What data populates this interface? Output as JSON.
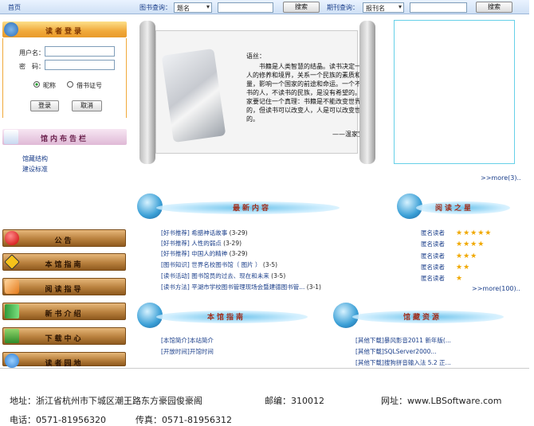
{
  "topbar": {
    "home": "首页",
    "book_query_label": "图书查询：",
    "book_select": "题名",
    "search_btn": "搜索",
    "journal_query_label": "期刊查询：",
    "journal_select": "报刊名",
    "search_btn2": "搜索"
  },
  "login": {
    "title": "读者登录",
    "user_label": "用户名：",
    "pwd_label": "密　码：",
    "radio1": "昵称",
    "radio2": "借书证号",
    "login_btn": "登录",
    "cancel_btn": "取消"
  },
  "bulletin": {
    "title": "馆内布告栏",
    "links": [
      "馆藏结构",
      "建设标准"
    ]
  },
  "scroll": {
    "quote_title": "语丝：",
    "quote_body": "书籍是人类智慧的结晶。读书决定一个人的修养和境界，关系一个民族的素质和力量，影响一个国家的前途和命运。一个不读书的人，不读书的民族，是没有希望的。大家要记住一个真理：书籍是不能改变世界的，但读书可以改变人，人是可以改变世界的。",
    "quote_author": "——温家宝"
  },
  "more1": ">>more(3)..",
  "newest": {
    "title": "最新内容",
    "items": [
      {
        "tag": "[好书推荐]",
        "text": "希腊神话故事",
        "date": "(3-29)"
      },
      {
        "tag": "[好书推荐]",
        "text": "人性的弱点",
        "date": "(3-29)"
      },
      {
        "tag": "[好书推荐]",
        "text": "中国人的精神",
        "date": "(3-29)"
      },
      {
        "tag": "[图书知识]",
        "text": "世界名校图书馆（ 图片 ）",
        "date": "(3-5)"
      },
      {
        "tag": "[读书活动]",
        "text": "图书馆员的过去、现在和未来",
        "date": "(3-5)"
      },
      {
        "tag": "[读书方法]",
        "text": "平湖市学校图书管理现场会暨建德图书管...",
        "date": "(3-1)"
      }
    ]
  },
  "stars": {
    "title": "阅读之星",
    "readers": [
      {
        "name": "匿名读者",
        "stars": "★★★★★"
      },
      {
        "name": "匿名读者",
        "stars": "★★★★"
      },
      {
        "name": "匿名读者",
        "stars": "★★★"
      },
      {
        "name": "匿名读者",
        "stars": "★★"
      },
      {
        "name": "匿名读者",
        "stars": "★"
      }
    ],
    "more": ">>more(100).."
  },
  "leftnav": [
    "公告",
    "本馆指南",
    "阅读指导",
    "新书介绍",
    "下载中心",
    "读者园地"
  ],
  "guide": {
    "title": "本馆指南",
    "items": [
      {
        "tag": "[本馆简介]",
        "text": "本站简介"
      },
      {
        "tag": "[开放时间]",
        "text": "开馆时间"
      }
    ]
  },
  "resources": {
    "title": "馆藏资源",
    "items": [
      {
        "tag": "[其他下载]",
        "text": "暴风影音2011 新年版(..."
      },
      {
        "tag": "[其他下载]",
        "text": "SQLServer2000..."
      },
      {
        "tag": "[其他下载]",
        "text": "搜狗拼音输入法 5.2 正..."
      }
    ]
  },
  "footer": {
    "address": "地址：浙江省杭州市下城区潮王路东方豪园俊豪阁",
    "zip": "邮编：310012",
    "site": "网址：www.LBSoftware.com",
    "phone": "电话：0571-81956320",
    "fax": "传真：0571-81956312"
  },
  "colors": {
    "accent": "#1a3e8a",
    "gold": "#f1a93a",
    "brown": "#b9813e",
    "orb": "#3a9fd6"
  }
}
